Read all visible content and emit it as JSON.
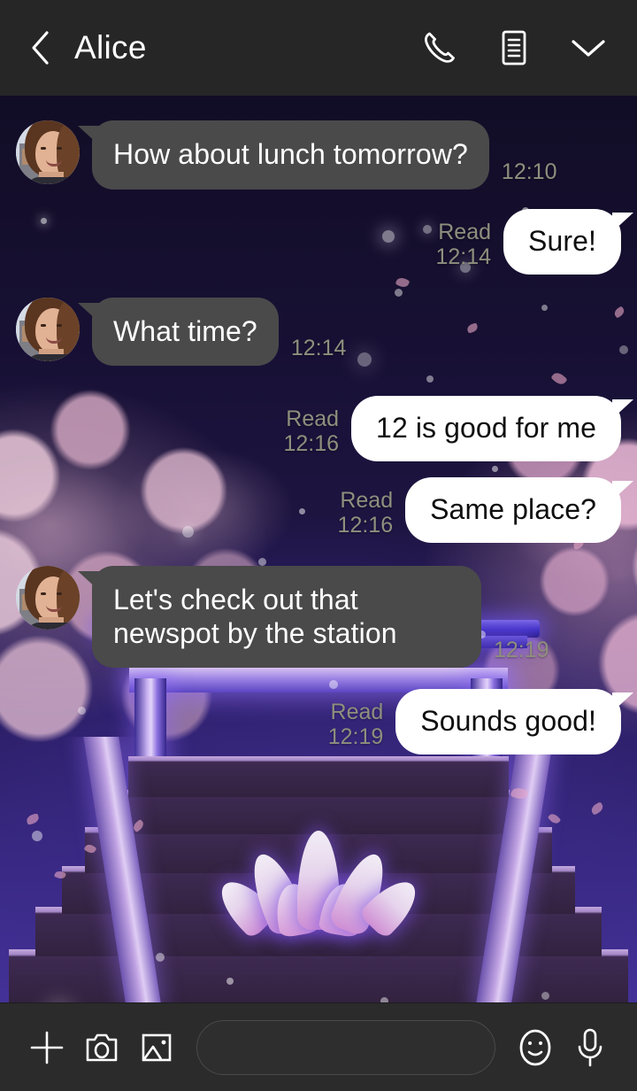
{
  "header": {
    "back_icon": "chevron-left-icon",
    "title": "Alice",
    "call_icon": "phone-icon",
    "notes_icon": "note-list-icon",
    "more_icon": "chevron-down-icon"
  },
  "wallpaper": {
    "description": "night sky torii gate with cherry blossoms, lotus and stone stairs",
    "sky_color": "#171033",
    "blossom_color": "#d7a8c6",
    "torii_glow_color": "#7a5fe0",
    "stair_color": "#3e2a52"
  },
  "colors": {
    "header_bg": "#262626",
    "incoming_bubble_bg": "#4a4a4a",
    "incoming_bubble_text": "#ffffff",
    "outgoing_bubble_bg": "#ffffff",
    "outgoing_bubble_text": "#0f0f0f",
    "timestamp_text": "#8f8f7e",
    "inputbar_bg": "#2b2b2b"
  },
  "conversation": {
    "contact_name": "Alice",
    "messages": [
      {
        "side": "in",
        "text": "How about lunch tomorrow?",
        "time": "12:10",
        "read": "",
        "show_avatar": true
      },
      {
        "side": "out",
        "text": "Sure!",
        "time": "12:14",
        "read": "Read",
        "show_avatar": false
      },
      {
        "side": "in",
        "text": "What time?",
        "time": "12:14",
        "read": "",
        "show_avatar": true
      },
      {
        "side": "out",
        "text": "12 is good for me",
        "time": "12:16",
        "read": "Read",
        "show_avatar": false
      },
      {
        "side": "out",
        "text": "Same place?",
        "time": "12:16",
        "read": "Read",
        "show_avatar": false
      },
      {
        "side": "in",
        "text": "Let's check out that newspot by the station",
        "time": "12:19",
        "read": "",
        "show_avatar": true
      },
      {
        "side": "out",
        "text": "Sounds good!",
        "time": "12:19",
        "read": "Read",
        "show_avatar": false
      }
    ]
  },
  "inputbar": {
    "add_icon": "plus-icon",
    "camera_icon": "camera-icon",
    "gallery_icon": "image-icon",
    "message_value": "",
    "message_placeholder": "",
    "emoji_icon": "smiley-icon",
    "mic_icon": "microphone-icon"
  }
}
